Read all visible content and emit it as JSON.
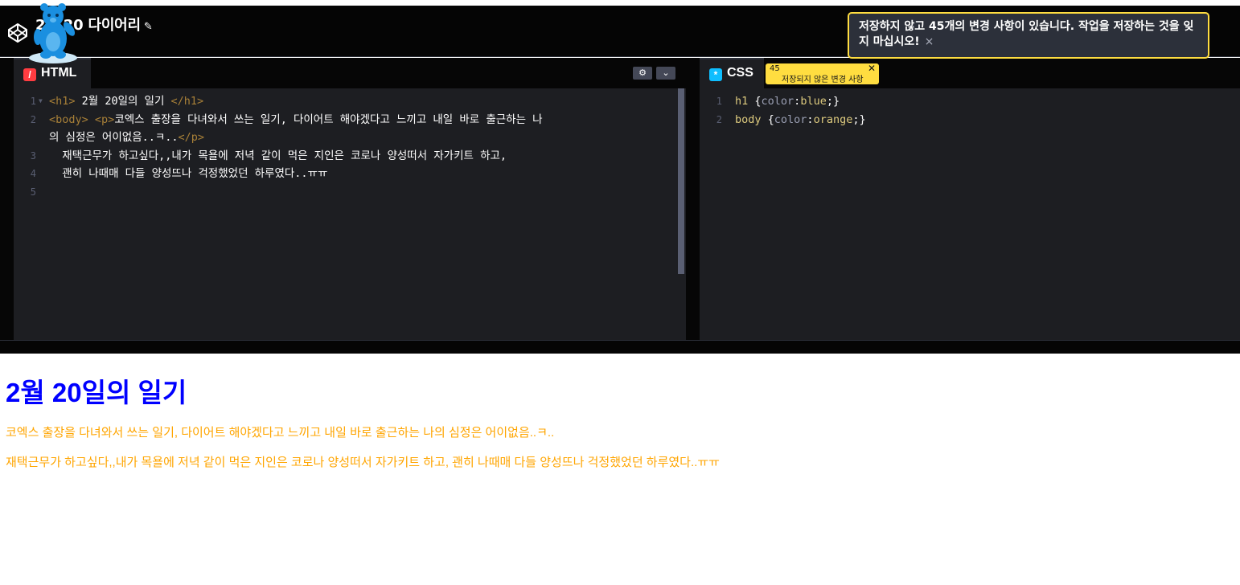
{
  "header": {
    "title": "2월 20 다이어리",
    "edit_icon": "pencil-icon"
  },
  "toast": {
    "message": "저장하지 않고 45개의 변경 사항이 있습니다. 작업을 저장하는 것을 잊지 마십시오!",
    "close": "×"
  },
  "html_panel": {
    "tab_label": "HTML",
    "icon": "html-slash-icon",
    "settings_icon": "gear-icon",
    "collapse_icon": "chevron-down-icon",
    "lines": [
      {
        "n": "1",
        "parts": [
          [
            "tag",
            "<h1>"
          ],
          [
            "text",
            " 2월 20일의 일기 "
          ],
          [
            "tag",
            "</h1>"
          ]
        ]
      },
      {
        "n": "2",
        "parts": [
          [
            "tag",
            "<body>"
          ],
          [
            "text",
            " "
          ],
          [
            "tag",
            "<p>"
          ],
          [
            "text",
            "코엑스 출장을 다녀와서 쓰는 일기, 다이어트 해야겠다고 느끼고 내일 바로 출근하는 나"
          ]
        ]
      },
      {
        "n": "",
        "parts": [
          [
            "text",
            "의 심정은 어이없음..ㅋ.."
          ],
          [
            "tag",
            "</p>"
          ]
        ]
      },
      {
        "n": "3",
        "parts": [
          [
            "text",
            "  재택근무가 하고싶다,,내가 목욜에 저녁 같이 먹은 지인은 코로나 양성떠서 자가키트 하고,"
          ]
        ]
      },
      {
        "n": "4",
        "parts": [
          [
            "text",
            "  괜히 나때매 다들 양성뜨나 걱정했었던 하루였다..ㅠㅠ"
          ]
        ]
      },
      {
        "n": "5",
        "parts": []
      }
    ]
  },
  "css_panel": {
    "tab_label": "CSS",
    "icon": "css-asterisk-icon",
    "unsaved_count": "45",
    "unsaved_label": "저장되지 않은 변경 사항",
    "lines": [
      {
        "n": "1",
        "selector": "h1",
        "prop": "color",
        "value": "blue"
      },
      {
        "n": "2",
        "selector": "body",
        "prop": "color",
        "value": "orange"
      }
    ]
  },
  "preview": {
    "heading": "2월 20일의 일기",
    "paragraph1": "코엑스 출장을 다녀와서 쓰는 일기, 다이어트 해야겠다고 느끼고 내일 바로 출근하는 나의 심정은 어이없음..ㅋ..",
    "paragraph2": "재택근무가 하고싶다,,내가 목욜에 저녁 같이 먹은 지인은 코로나 양성떠서 자가키트 하고, 괜히 나때매 다들 양성뜨나 걱정했었던 하루였다..ㅠㅠ"
  },
  "colors": {
    "accent_yellow": "#ffdd40",
    "html_icon": "#ff3c41",
    "css_icon": "#0ebeff",
    "preview_heading": "#0000ff",
    "preview_text": "#ffa500"
  }
}
